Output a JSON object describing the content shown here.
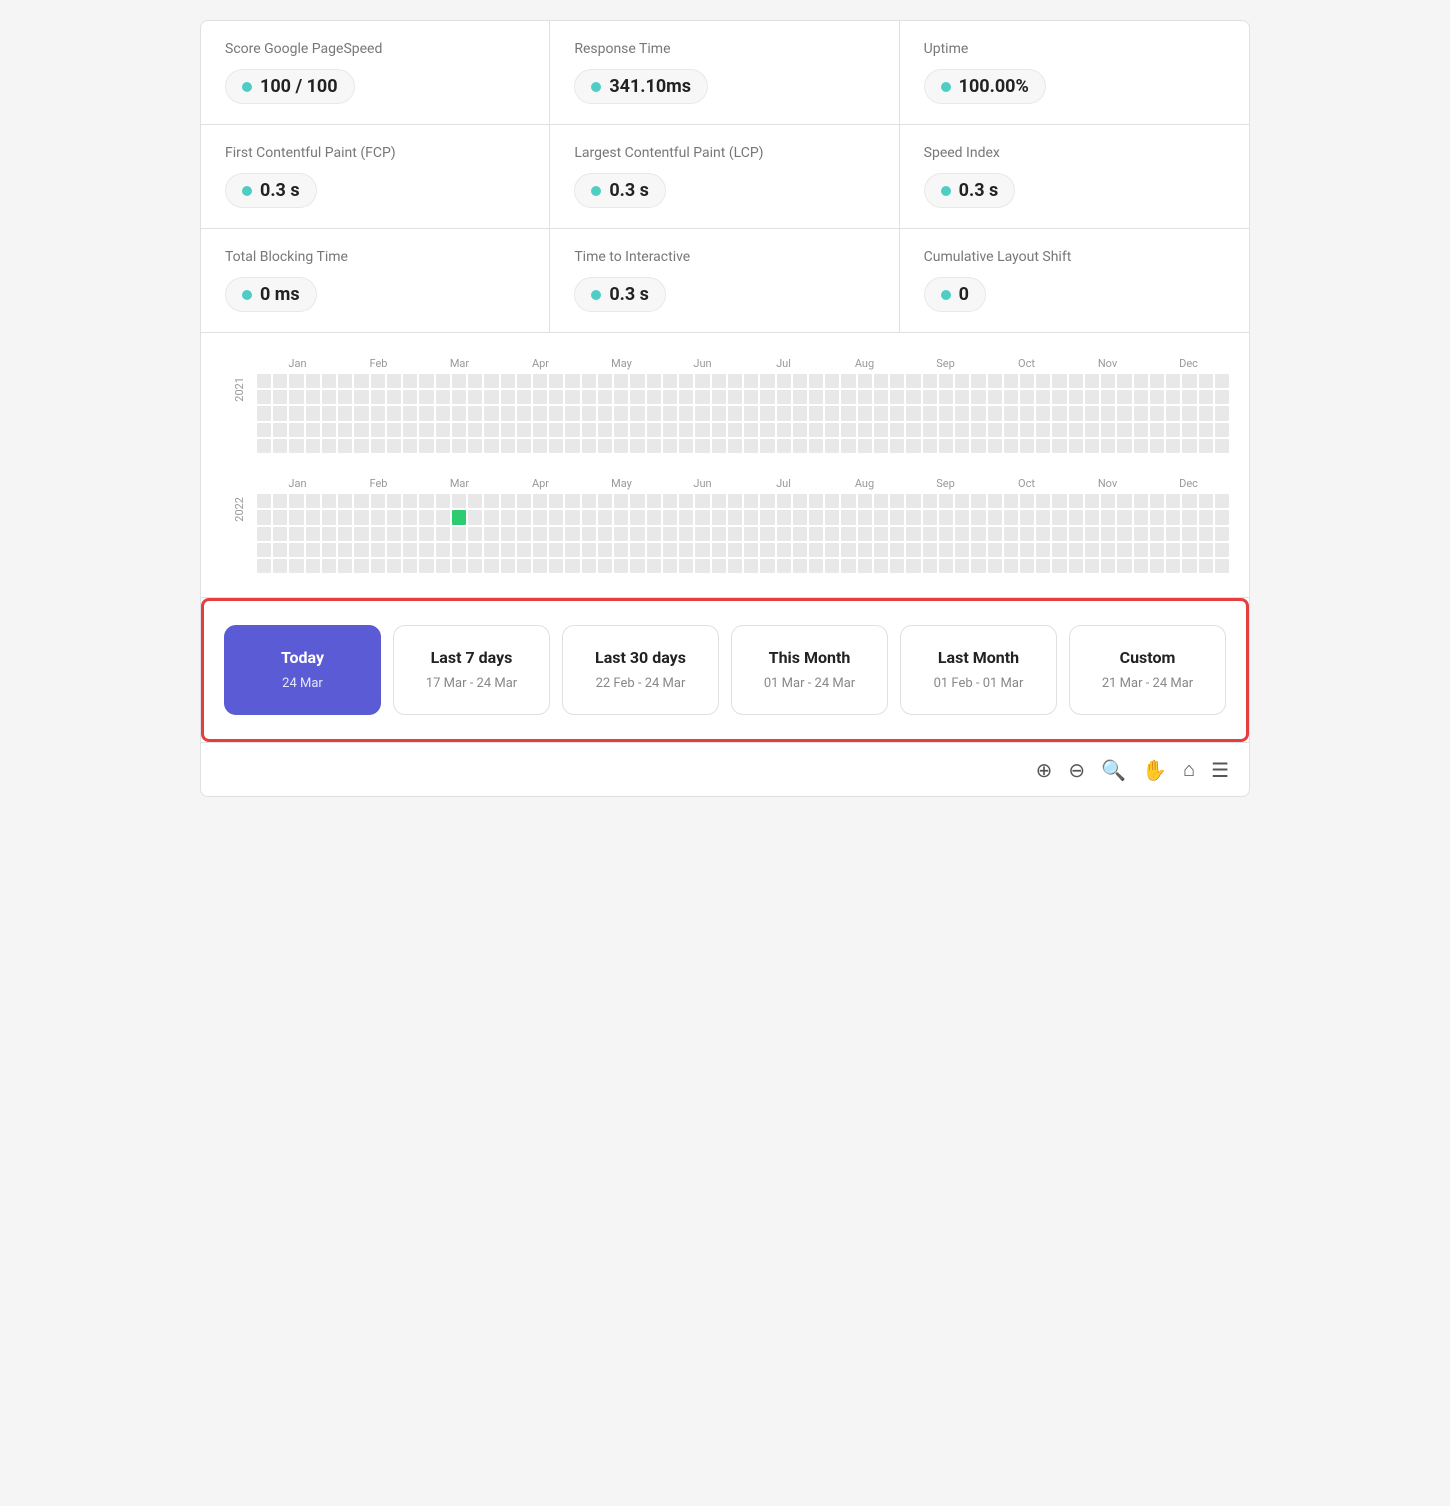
{
  "metrics": {
    "row1": [
      {
        "label": "Score Google PageSpeed",
        "value": "100 / 100"
      },
      {
        "label": "Response Time",
        "value": "341.10ms"
      },
      {
        "label": "Uptime",
        "value": "100.00%"
      }
    ],
    "row2": [
      {
        "label": "First Contentful Paint (FCP)",
        "value": "0.3 s"
      },
      {
        "label": "Largest Contentful Paint (LCP)",
        "value": "0.3 s"
      },
      {
        "label": "Speed Index",
        "value": "0.3 s"
      }
    ],
    "row3": [
      {
        "label": "Total Blocking Time",
        "value": "0 ms"
      },
      {
        "label": "Time to Interactive",
        "value": "0.3 s"
      },
      {
        "label": "Cumulative Layout Shift",
        "value": "0"
      }
    ]
  },
  "heatmap": {
    "months": [
      "Jan",
      "Feb",
      "Mar",
      "Apr",
      "May",
      "Jun",
      "Jul",
      "Aug",
      "Sep",
      "Oct",
      "Nov",
      "Dec"
    ],
    "years": [
      "2021",
      "2022"
    ],
    "active_cell": {
      "year": 1,
      "month": 2,
      "cell": 7
    }
  },
  "datepicker": {
    "options": [
      {
        "id": "today",
        "title": "Today",
        "range": "24 Mar",
        "active": true
      },
      {
        "id": "last7",
        "title": "Last 7 days",
        "range": "17 Mar - 24 Mar",
        "active": false
      },
      {
        "id": "last30",
        "title": "Last 30 days",
        "range": "22 Feb - 24 Mar",
        "active": false
      },
      {
        "id": "thismonth",
        "title": "This Month",
        "range": "01 Mar - 24 Mar",
        "active": false
      },
      {
        "id": "lastmonth",
        "title": "Last Month",
        "range": "01 Feb - 01 Mar",
        "active": false
      },
      {
        "id": "custom",
        "title": "Custom",
        "range": "21 Mar - 24 Mar",
        "active": false
      }
    ]
  },
  "toolbar": {
    "icons": [
      "zoom-in-icon",
      "zoom-out-icon",
      "search-icon",
      "hand-icon",
      "home-icon",
      "menu-icon"
    ]
  }
}
